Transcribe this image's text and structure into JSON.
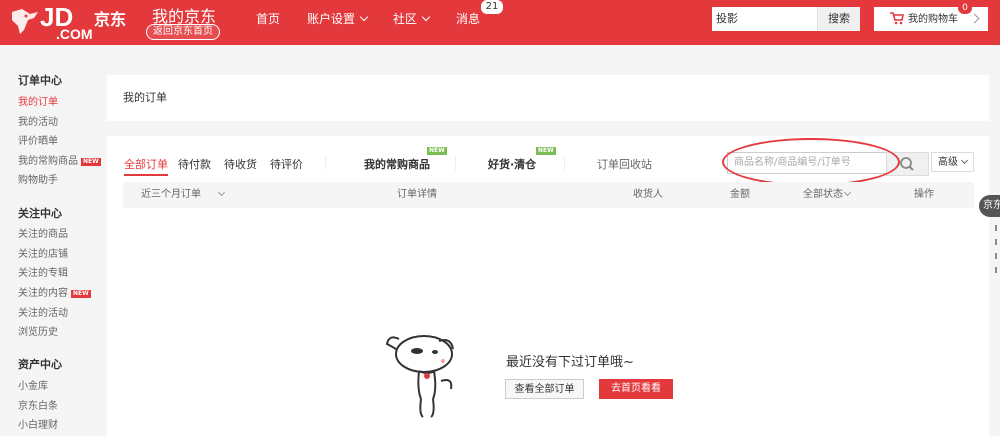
{
  "header": {
    "logo_jd": "JD",
    "logo_cn": "京东",
    "logo_com": ".COM",
    "title": "我的京东",
    "back_home": "返回京东首页",
    "nav": [
      {
        "label": "首页"
      },
      {
        "label": "账户设置"
      },
      {
        "label": "社区"
      },
      {
        "label": "消息"
      }
    ],
    "message_count": "21",
    "search_value": "投影",
    "search_button": "搜索",
    "cart_label": "我的购物车",
    "cart_count": "0"
  },
  "sidebar": {
    "sections": [
      {
        "title": "订单中心",
        "items": [
          "我的订单",
          "我的活动",
          "评价晒单",
          "我的常购商品",
          "购物助手"
        ]
      },
      {
        "title": "关注中心",
        "items": [
          "关注的商品",
          "关注的店铺",
          "关注的专辑",
          "关注的内容",
          "关注的活动",
          "浏览历史"
        ]
      },
      {
        "title": "资产中心",
        "items": [
          "小金库",
          "京东白条",
          "小白理财"
        ]
      }
    ],
    "new_tag": "NEW"
  },
  "main": {
    "panel_title": "我的订单",
    "tabs": [
      "全部订单",
      "待付款",
      "待收货",
      "待评价"
    ],
    "tab_frequent": "我的常购商品",
    "tab_clearance": "好货·清仓",
    "new_flag": "NEW",
    "tab_recycle": "订单回收站",
    "search_placeholder": "商品名称/商品编号/订单号",
    "advanced_label": "高级",
    "columns": {
      "period": "近三个月订单",
      "detail": "订单详情",
      "receiver": "收货人",
      "amount": "金额",
      "status": "全部状态",
      "action": "操作"
    },
    "empty_message": "最近没有下过订单哦~",
    "btn_view_all": "查看全部订单",
    "btn_go_home": "去首页看看"
  },
  "float_tab": "京东",
  "colors": {
    "brand": "#e4393c",
    "new_flag": "#7abd54"
  }
}
